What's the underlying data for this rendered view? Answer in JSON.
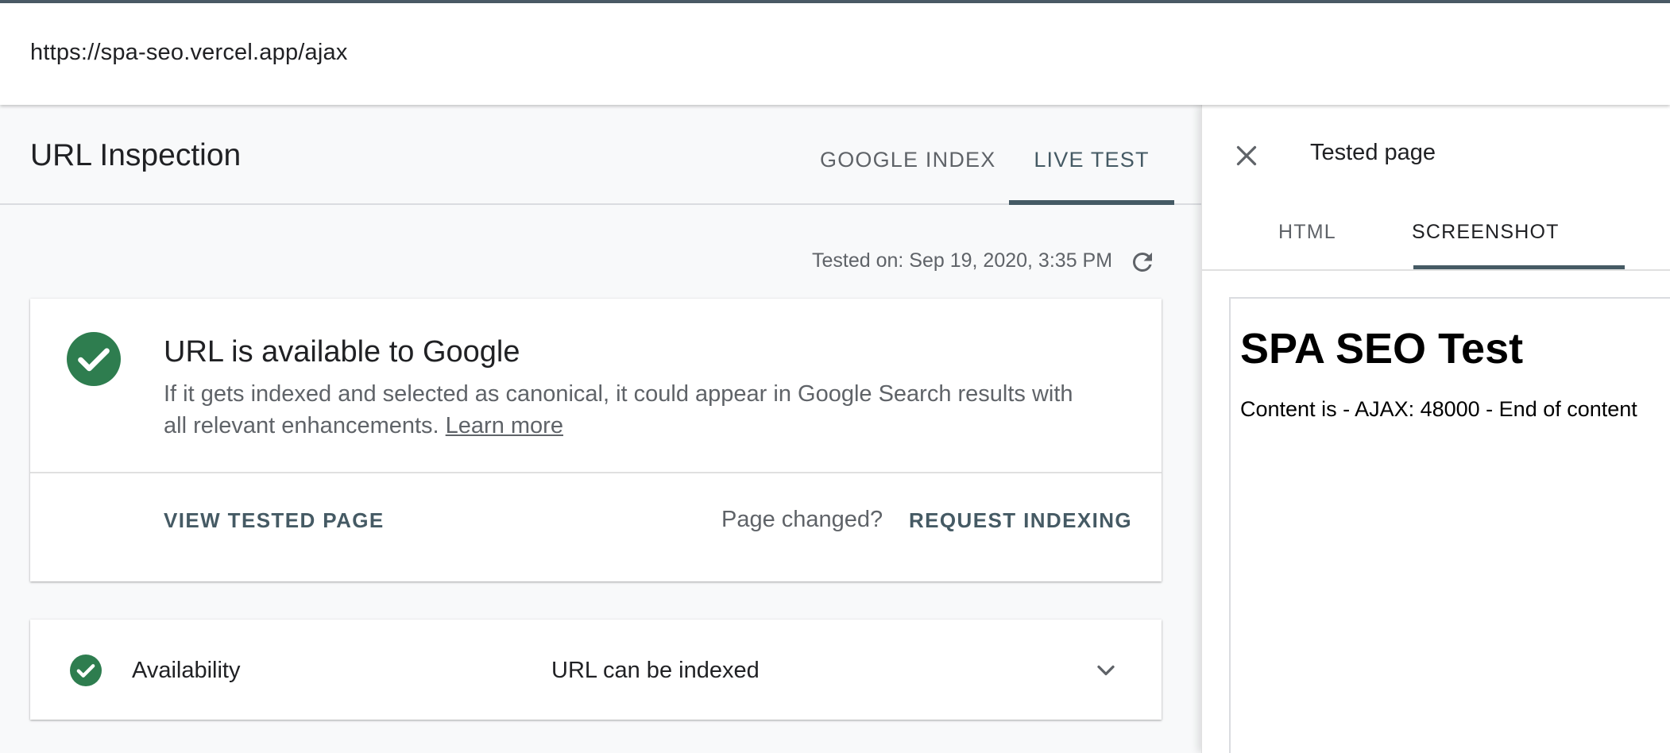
{
  "address_bar": {
    "url": "https://spa-seo.vercel.app/ajax"
  },
  "header": {
    "title": "URL Inspection",
    "tabs": [
      {
        "label": "GOOGLE INDEX",
        "active": false
      },
      {
        "label": "LIVE TEST",
        "active": true
      }
    ]
  },
  "test_info": {
    "tested_on": "Tested on: Sep 19, 2020, 3:35 PM",
    "refresh_icon": "refresh-icon"
  },
  "status_card": {
    "icon": "check-circle-icon",
    "title": "URL is available to Google",
    "description": "If it gets indexed and selected as canonical, it could appear in Google Search results with all relevant enhancements.",
    "learn_more": "Learn more",
    "view_tested_page": "VIEW TESTED PAGE",
    "page_changed": "Page changed?",
    "request_indexing": "REQUEST INDEXING"
  },
  "availability": {
    "icon": "check-circle-icon",
    "label": "Availability",
    "value": "URL can be indexed",
    "expand_icon": "chevron-down-icon"
  },
  "panel": {
    "close_icon": "close-icon",
    "title": "Tested page",
    "tabs": [
      {
        "label": "HTML",
        "active": false
      },
      {
        "label": "SCREENSHOT",
        "active": true
      }
    ],
    "screenshot": {
      "heading": "SPA SEO Test",
      "content": "Content is - AJAX: 48000 - End of content"
    }
  },
  "colors": {
    "accent": "#455a64",
    "success": "#2e7d4f",
    "text_primary": "#202124",
    "text_secondary": "#5f6368"
  }
}
